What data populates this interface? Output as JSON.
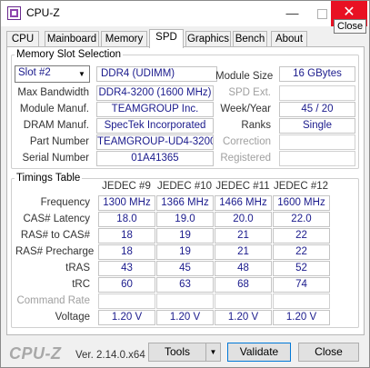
{
  "window": {
    "title": "CPU-Z",
    "minimize_glyph": "—",
    "close_glyph": "✕",
    "close_tooltip": "Close"
  },
  "tabs": [
    {
      "label": "CPU",
      "active": false
    },
    {
      "label": "Mainboard",
      "active": false
    },
    {
      "label": "Memory",
      "active": false
    },
    {
      "label": "SPD",
      "active": true
    },
    {
      "label": "Graphics",
      "active": false
    },
    {
      "label": "Bench",
      "active": false
    },
    {
      "label": "About",
      "active": false
    }
  ],
  "slot_section": {
    "title": "Memory Slot Selection",
    "slot_select": {
      "value": "Slot #2",
      "arrow": "▼"
    },
    "module_type": "DDR4 (UDIMM)",
    "max_bandwidth": {
      "label": "Max Bandwidth",
      "value": "DDR4-3200 (1600 MHz)"
    },
    "module_manuf": {
      "label": "Module Manuf.",
      "value": "TEAMGROUP Inc."
    },
    "dram_manuf": {
      "label": "DRAM Manuf.",
      "value": "SpecTek Incorporated"
    },
    "part_number": {
      "label": "Part Number",
      "value": "TEAMGROUP-UD4-3200"
    },
    "serial_number": {
      "label": "Serial Number",
      "value": "01A41365"
    },
    "module_size": {
      "label": "Module Size",
      "value": "16 GBytes"
    },
    "spd_ext": {
      "label": "SPD Ext.",
      "value": ""
    },
    "week_year": {
      "label": "Week/Year",
      "value": "45 / 20"
    },
    "ranks": {
      "label": "Ranks",
      "value": "Single"
    },
    "correction": {
      "label": "Correction",
      "value": ""
    },
    "registered": {
      "label": "Registered",
      "value": ""
    }
  },
  "timings_section": {
    "title": "Timings Table",
    "columns": [
      "JEDEC #9",
      "JEDEC #10",
      "JEDEC #11",
      "JEDEC #12"
    ],
    "rows": [
      {
        "label": "Frequency",
        "values": [
          "1300 MHz",
          "1366 MHz",
          "1466 MHz",
          "1600 MHz"
        ],
        "dim": false
      },
      {
        "label": "CAS# Latency",
        "values": [
          "18.0",
          "19.0",
          "20.0",
          "22.0"
        ],
        "dim": false
      },
      {
        "label": "RAS# to CAS#",
        "values": [
          "18",
          "19",
          "21",
          "22"
        ],
        "dim": false
      },
      {
        "label": "RAS# Precharge",
        "values": [
          "18",
          "19",
          "21",
          "22"
        ],
        "dim": false
      },
      {
        "label": "tRAS",
        "values": [
          "43",
          "45",
          "48",
          "52"
        ],
        "dim": false
      },
      {
        "label": "tRC",
        "values": [
          "60",
          "63",
          "68",
          "74"
        ],
        "dim": false
      },
      {
        "label": "Command Rate",
        "values": [
          "",
          "",
          "",
          ""
        ],
        "dim": true
      },
      {
        "label": "Voltage",
        "values": [
          "1.20 V",
          "1.20 V",
          "1.20 V",
          "1.20 V"
        ],
        "dim": false
      }
    ]
  },
  "footer": {
    "logo": "CPU-Z",
    "version": "Ver. 2.14.0.x64",
    "tools_label": "Tools",
    "tools_arrow": "▼",
    "validate_label": "Validate",
    "close_label": "Close"
  }
}
